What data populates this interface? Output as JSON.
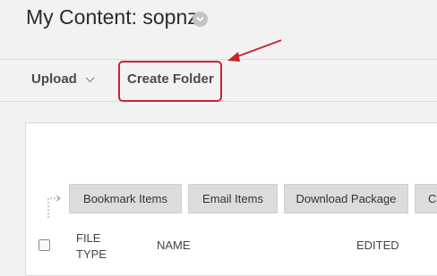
{
  "header": {
    "title": "My Content: sopnz"
  },
  "action_bar": {
    "upload_label": "Upload",
    "create_folder_label": "Create Folder"
  },
  "toolbar": {
    "buttons": [
      "Bookmark Items",
      "Email Items",
      "Download Package",
      "Co"
    ]
  },
  "table": {
    "columns": [
      "FILE TYPE",
      "NAME",
      "EDITED"
    ]
  },
  "colors": {
    "annotation": "#c6262e",
    "background": "#f2f2f2",
    "panel": "#ffffff"
  }
}
